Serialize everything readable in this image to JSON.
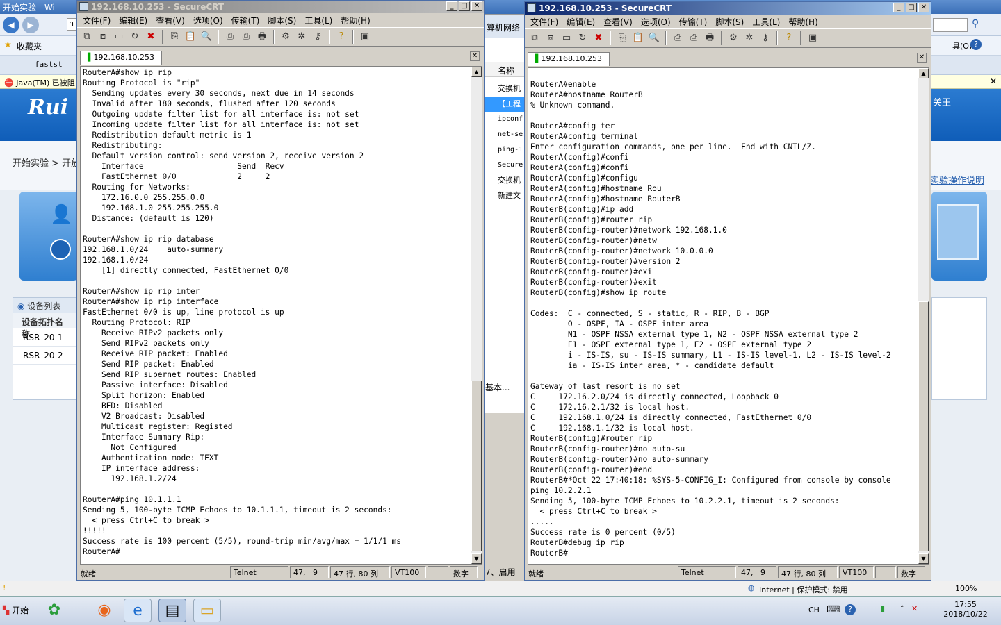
{
  "ie": {
    "title": "开始实验 - Wi",
    "address_partial": "h",
    "favorites_label": "收藏夹",
    "tab_label": "fastst",
    "infobar": "Java(TM) 已被阻",
    "breadcrumb": "开始实验 > 开放",
    "right_link": "实验操作说明",
    "right_menu_tools": "具(O)",
    "right_toplabel": "关王",
    "devlist": {
      "title": "设备列表",
      "header": "设备拓扑名称",
      "rows": [
        "RSR_20-1",
        "RSR_20-2"
      ]
    },
    "status": {
      "zone": "Internet | 保护模式: 禁用",
      "zoom": "100%"
    }
  },
  "midwin": {
    "top": "算机网络",
    "header": "名称",
    "items": [
      "交换机",
      "【工程",
      "ipconf",
      "net-se",
      "ping-1",
      "Secure",
      "交换机",
      "新建文"
    ],
    "bottom1": "基本...",
    "bottom2": "7、启用"
  },
  "crt_left": {
    "title": "192.168.10.253 - SecureCRT",
    "menu": [
      "文件(F)",
      "编辑(E)",
      "查看(V)",
      "选项(O)",
      "传输(T)",
      "脚本(S)",
      "工具(L)",
      "帮助(H)"
    ],
    "tab": "192.168.10.253",
    "terminal": "RouterA#show ip rip\nRouting Protocol is \"rip\"\n  Sending updates every 30 seconds, next due in 14 seconds\n  Invalid after 180 seconds, flushed after 120 seconds\n  Outgoing update filter list for all interface is: not set\n  Incoming update filter list for all interface is: not set\n  Redistribution default metric is 1\n  Redistributing:\n  Default version control: send version 2, receive version 2\n    Interface                    Send  Recv\n    FastEthernet 0/0             2     2\n  Routing for Networks:\n    172.16.0.0 255.255.0.0\n    192.168.1.0 255.255.255.0\n  Distance: (default is 120)\n\nRouterA#show ip rip database\n192.168.1.0/24    auto-summary\n192.168.1.0/24\n    [1] directly connected, FastEthernet 0/0\n\nRouterA#show ip rip inter\nRouterA#show ip rip interface\nFastEthernet 0/0 is up, line protocol is up\n  Routing Protocol: RIP\n    Receive RIPv2 packets only\n    Send RIPv2 packets only\n    Receive RIP packet: Enabled\n    Send RIP packet: Enabled\n    Send RIP supernet routes: Enabled\n    Passive interface: Disabled\n    Split horizon: Enabled\n    BFD: Disabled\n    V2 Broadcast: Disabled\n    Multicast register: Registed\n    Interface Summary Rip:\n      Not Configured\n    Authentication mode: TEXT\n    IP interface address:\n      192.168.1.2/24\n\nRouterA#ping 10.1.1.1\nSending 5, 100-byte ICMP Echoes to 10.1.1.1, timeout is 2 seconds:\n  < press Ctrl+C to break >\n!!!!!\nSuccess rate is 100 percent (5/5), round-trip min/avg/max = 1/1/1 ms\nRouterA#",
    "status": [
      "就绪",
      "Telnet",
      "47,   9",
      "47 行, 80 列",
      "VT100",
      "",
      "数字"
    ]
  },
  "crt_right": {
    "title": "192.168.10.253 - SecureCRT",
    "menu": [
      "文件(F)",
      "编辑(E)",
      "查看(V)",
      "选项(O)",
      "传输(T)",
      "脚本(S)",
      "工具(L)",
      "帮助(H)"
    ],
    "tab": "192.168.10.253",
    "terminal": "RouterA#enable\nRouterA#hostname RouterB\n% Unknown command.\n\nRouterA#config ter\nRouterA#config terminal\nEnter configuration commands, one per line.  End with CNTL/Z.\nRouterA(config)#confi\nRouterA(config)#confi\nRouterA(config)#configu\nRouterA(config)#hostname Rou\nRouterA(config)#hostname RouterB\nRouterB(config)#ip add\nRouterB(config)#router rip\nRouterB(config-router)#network 192.168.1.0\nRouterB(config-router)#netw\nRouterB(config-router)#network 10.0.0.0\nRouterB(config-router)#version 2\nRouterB(config-router)#exi\nRouterB(config-router)#exit\nRouterB(config)#show ip route\n\nCodes:  C - connected, S - static, R - RIP, B - BGP\n        O - OSPF, IA - OSPF inter area\n        N1 - OSPF NSSA external type 1, N2 - OSPF NSSA external type 2\n        E1 - OSPF external type 1, E2 - OSPF external type 2\n        i - IS-IS, su - IS-IS summary, L1 - IS-IS level-1, L2 - IS-IS level-2\n        ia - IS-IS inter area, * - candidate default\n\nGateway of last resort is no set\nC     172.16.2.0/24 is directly connected, Loopback 0\nC     172.16.2.1/32 is local host.\nC     192.168.1.0/24 is directly connected, FastEthernet 0/0\nC     192.168.1.1/32 is local host.\nRouterB(config)#router rip\nRouterB(config-router)#no auto-su\nRouterB(config-router)#no auto-summary\nRouterB(config-router)#end\nRouterB#*Oct 22 17:40:18: %SYS-5-CONFIG_I: Configured from console by console\nping 10.2.2.1\nSending 5, 100-byte ICMP Echoes to 10.2.2.1, timeout is 2 seconds:\n  < press Ctrl+C to break >\n.....\nSuccess rate is 0 percent (0/5)\nRouterB#debug ip rip\nRouterB#",
    "status": [
      "就绪",
      "Telnet",
      "47,   9",
      "47 行, 80 列",
      "VT100",
      "",
      "数字"
    ]
  },
  "taskbar": {
    "start": "开始",
    "lang": "CH",
    "time": "17:55",
    "date": "2018/10/22"
  },
  "colors": {
    "title_active": "#0a246a",
    "title_inactive": "#808080",
    "ruijie_blue": "#0f5db8"
  }
}
